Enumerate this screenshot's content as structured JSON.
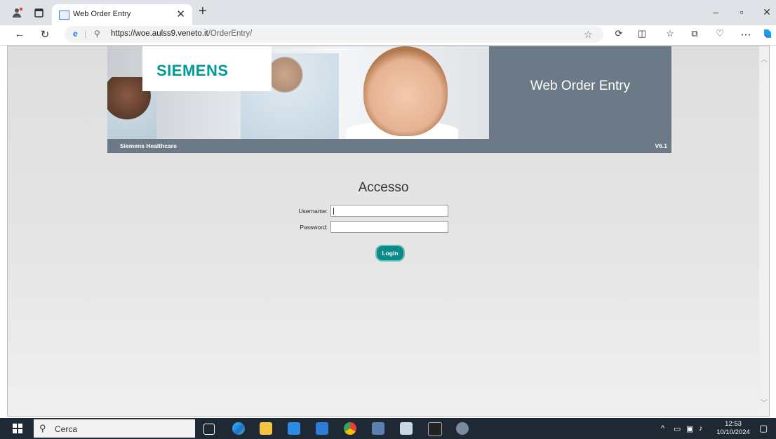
{
  "browser": {
    "tab_title": "Web Order Entry",
    "url_host": "https://woe.aulss9.veneto.it",
    "url_path": "/OrderEntry/"
  },
  "banner": {
    "logo": "SIEMENS",
    "app_title": "Web Order Entry",
    "footer_left": "Siemens Healthcare",
    "version": "V6.1"
  },
  "login": {
    "heading": "Accesso",
    "username_label": "Username:",
    "username_value": "",
    "password_label": "Password:",
    "password_value": "",
    "button_label": "Login"
  },
  "taskbar": {
    "search_placeholder": "Cerca",
    "time": "12:53",
    "date": "10/10/2024"
  },
  "colors": {
    "siemens_teal": "#009999",
    "banner_slate": "#6c7a87",
    "login_button": "#0b8a8a",
    "taskbar": "#1f2933"
  }
}
